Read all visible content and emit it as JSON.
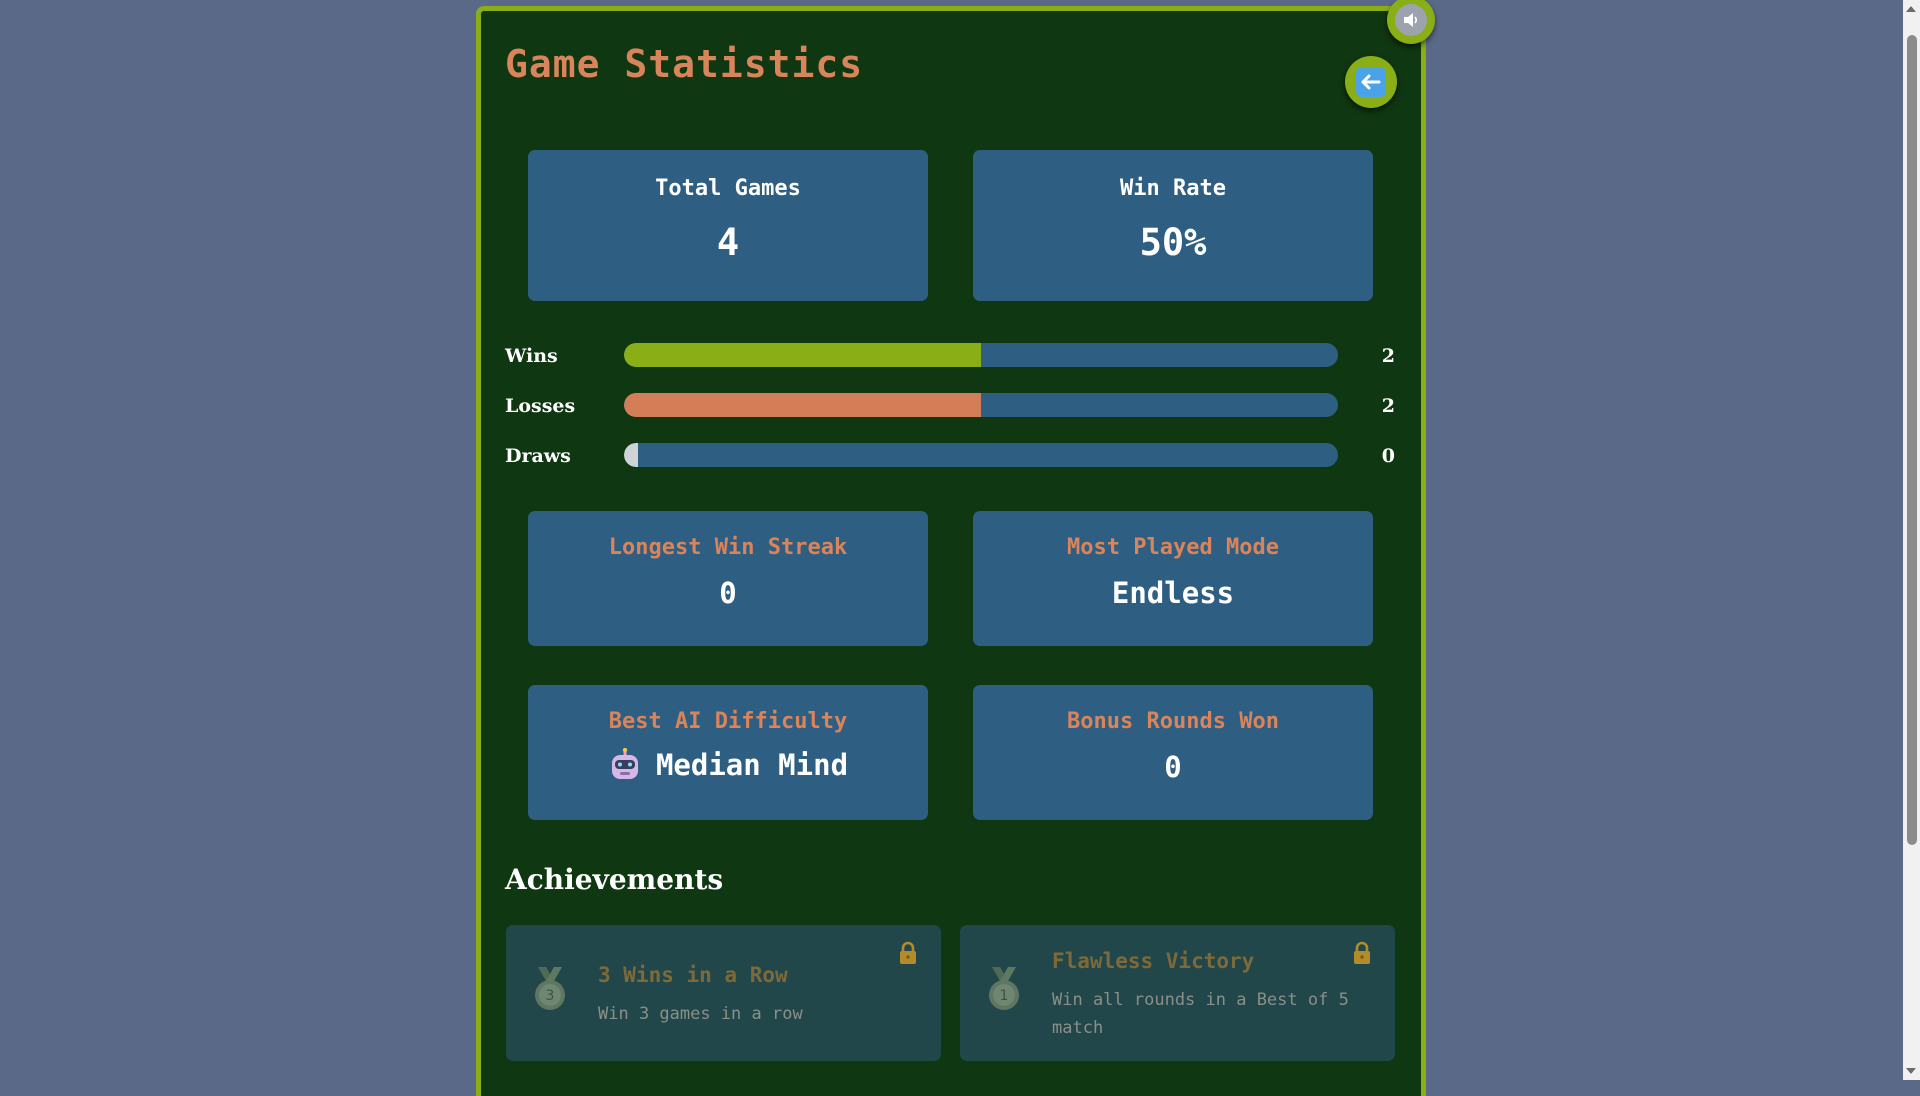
{
  "header": {
    "title": "Game Statistics",
    "sound_icon": "speaker-icon",
    "back_icon": "back-arrow-icon"
  },
  "summary": {
    "total_games": {
      "label": "Total Games",
      "value": "4"
    },
    "win_rate": {
      "label": "Win Rate",
      "value": "50%"
    }
  },
  "results": [
    {
      "label": "Wins",
      "count": "2",
      "fraction": 0.5,
      "color": "#8aae16"
    },
    {
      "label": "Losses",
      "count": "2",
      "fraction": 0.5,
      "color": "#d47e58"
    },
    {
      "label": "Draws",
      "count": "0",
      "fraction": 0,
      "color": "#cfd3d6"
    }
  ],
  "details": {
    "longest_streak": {
      "label": "Longest Win Streak",
      "value": "0"
    },
    "most_played": {
      "label": "Most Played Mode",
      "value": "Endless"
    },
    "best_ai": {
      "label": "Best AI Difficulty",
      "value": "Median Mind",
      "icon": "robot-icon"
    },
    "bonus_rounds": {
      "label": "Bonus Rounds Won",
      "value": "0"
    }
  },
  "achievements": {
    "heading": "Achievements",
    "items": [
      {
        "title": "3 Wins in a Row",
        "desc": "Win 3 games in a row",
        "medal_number": "3",
        "locked": true
      },
      {
        "title": "Flawless Victory",
        "desc": "Win all rounds in a Best of 5 match",
        "medal_number": "1",
        "locked": true
      }
    ]
  },
  "colors": {
    "page_bg": "#5b6989",
    "panel_bg": "#0f3711",
    "border_accent": "#8aae16",
    "card_bg": "#2e5f83",
    "title_orange": "#d9845a"
  }
}
